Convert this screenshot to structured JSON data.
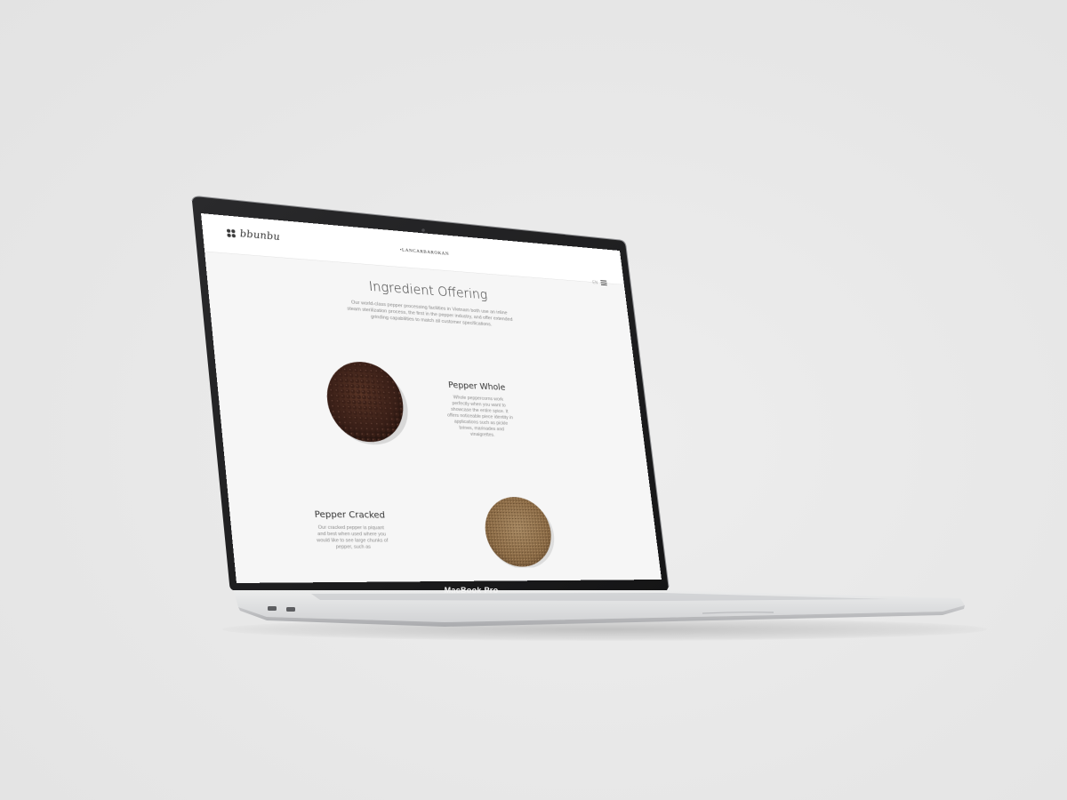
{
  "device": {
    "model_label": "MacBook Pro"
  },
  "site": {
    "logo_text": "bbunbu",
    "nav_brand": "•LANCARBAROKAN",
    "language": "EN",
    "page_title": "Ingredient Offering",
    "intro": "Our world-class pepper processing facilities in Vietnam both use an inline steam sterilization process, the first in the pepper industry, and offer extended grinding capabilities to match all customer specifications.",
    "products": [
      {
        "title": "Pepper Whole",
        "description": "Whole peppercorns work perfectly when you want to showcase the entire spice. It offers noticeable piece identity in applications such as pickle brines, marinades and vinaigrettes.",
        "image_icon": "peppercorns-pile-image",
        "color": "#3b2018"
      },
      {
        "title": "Pepper Cracked",
        "description": "Our cracked pepper is piquant and best when used where you would like to see large chunks of pepper, such as",
        "image_icon": "cracked-pepper-pile-image",
        "color": "#8a6a45"
      }
    ],
    "menu_icon": "hamburger-menu-icon"
  },
  "colors": {
    "background": "#e9e9e9",
    "screen_bg": "#f6f6f6",
    "bezel": "#1d1d1f",
    "aluminum": "#d9dadc"
  }
}
